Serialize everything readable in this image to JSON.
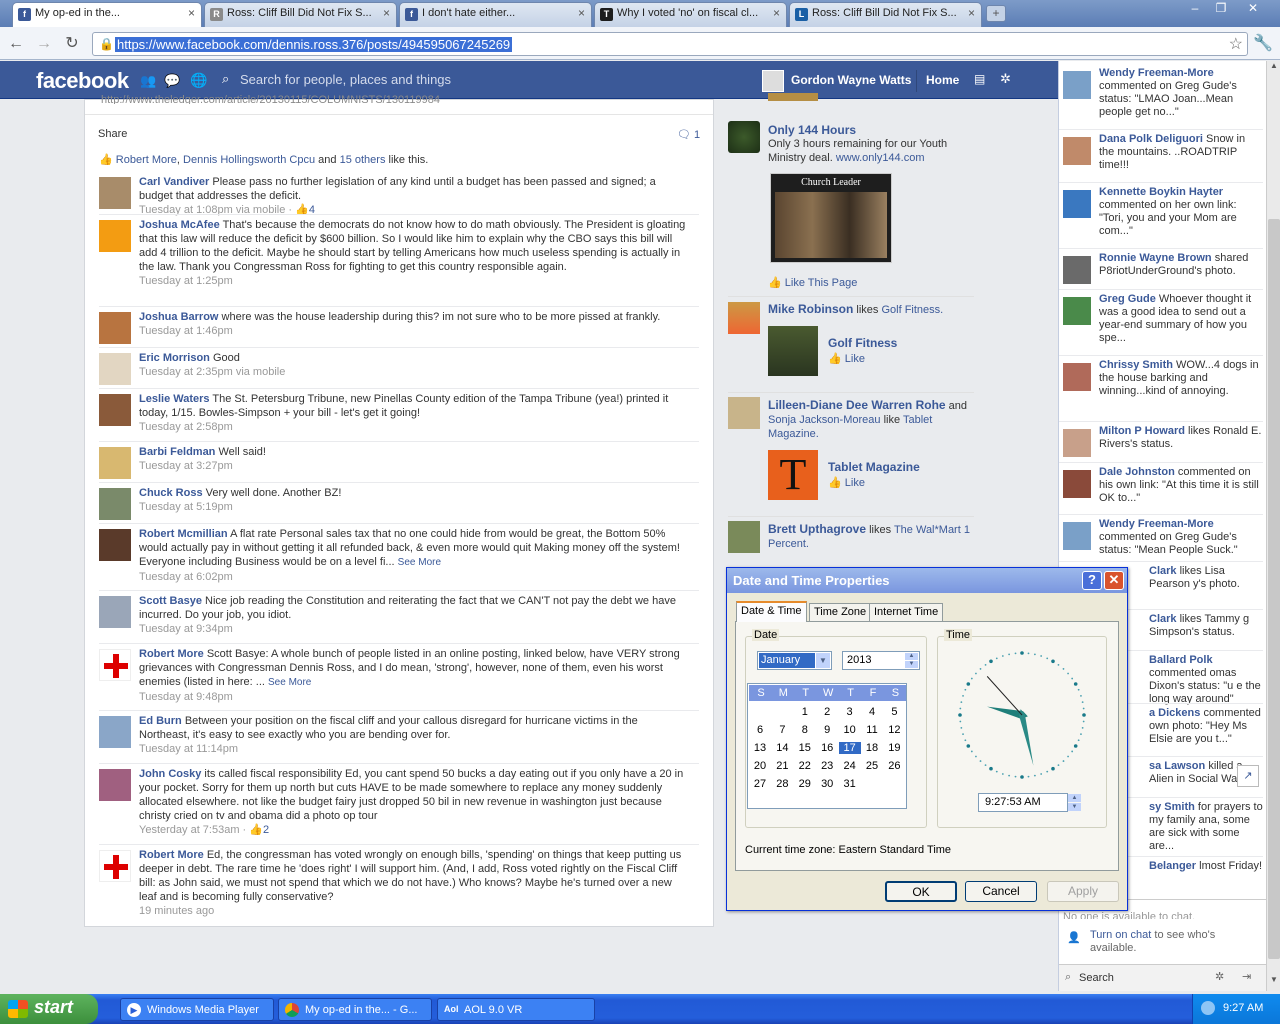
{
  "browser": {
    "tabs": [
      {
        "title": "My op-ed in the...",
        "icon": "facebook-icon"
      },
      {
        "title": "Ross: Cliff Bill Did Not Fix S...",
        "icon": "page-icon"
      },
      {
        "title": "I don't hate either...",
        "icon": "facebook-icon"
      },
      {
        "title": "Why I voted 'no' on fiscal cl...",
        "icon": "page-icon"
      },
      {
        "title": "Ross: Cliff Bill Did Not Fix S...",
        "icon": "page-icon"
      }
    ],
    "url": "https://www.facebook.com/dennis.ross.376/posts/494595067245269"
  },
  "fb": {
    "logo": "facebook",
    "search_placeholder": "Search for people, places and things",
    "user": "Gordon Wayne Watts",
    "home": "Home"
  },
  "post": {
    "link_fragment": "http://www.theledger.com/article/20130115/COLUMNISTS/130119984",
    "share": "Share",
    "comment_count": "1",
    "likes_text": {
      "a": "Robert More",
      "sep1": ",",
      "b": "Dennis Hollingsworth Cpcu",
      "and": "and",
      "others": "15 others",
      "tail": "like this."
    },
    "comments": [
      {
        "name": "Carl Vandiver",
        "text": "Please pass no further legislation of any kind until a budget has been passed and signed; a budget that addresses the deficit.",
        "meta": "Tuesday at 1:08pm via mobile",
        "likes": "4"
      },
      {
        "name": "Joshua McAfee",
        "text": "That's because the democrats do not know how to do math obviously. The President is gloating that this law will reduce the deficit by $600 billion. So I would like him to explain why the CBO says this bill will add 4 trillion to the deficit. Maybe he should start by telling Americans how much useless spending is actually in the law. Thank you Congressman Ross for fighting to get this country responsible again.",
        "meta": "Tuesday at 1:25pm",
        "likes": ""
      },
      {
        "name": "Joshua Barrow",
        "text": "where was the house leadership during this? im not sure who to be more pissed at frankly.",
        "meta": "Tuesday at 1:46pm",
        "likes": ""
      },
      {
        "name": "Eric Morrison",
        "text": "Good",
        "meta": "Tuesday at 2:35pm via mobile",
        "likes": ""
      },
      {
        "name": "Leslie Waters",
        "text": "The St. Petersburg Tribune, new Pinellas County edition of the Tampa Tribune (yea!) printed it today, 1/15. Bowles-Simpson + your bill - let's get it going!",
        "meta": "Tuesday at 2:58pm",
        "likes": ""
      },
      {
        "name": "Barbi Feldman",
        "text": "Well said!",
        "meta": "Tuesday at 3:27pm",
        "likes": ""
      },
      {
        "name": "Chuck Ross",
        "text": "Very well done. Another BZ!",
        "meta": "Tuesday at 5:19pm",
        "likes": ""
      },
      {
        "name": "Robert Mcmillian",
        "text": "A flat rate Personal sales tax that no one could hide from would be great, the Bottom 50% would actually pay in without getting it all refunded back, & even more would quit Making money off the system! Everyone including Business would be on a level fi...",
        "see_more": "See More",
        "meta": "Tuesday at 6:02pm",
        "likes": ""
      },
      {
        "name": "Scott Basye",
        "text": "Nice job reading the Constitution and reiterating the fact that we CAN'T not pay the debt we have incurred. Do your job, you idiot.",
        "meta": "Tuesday at 9:34pm",
        "likes": ""
      },
      {
        "name": "Robert More",
        "text": "Scott Basye: A whole bunch of people listed in an online posting, linked below, have VERY strong grievances with Congressman Dennis Ross, and I do mean, 'strong', however, none of them, even his worst enemies (listed in here: ...",
        "see_more": "See More",
        "meta": "Tuesday at 9:48pm",
        "likes": ""
      },
      {
        "name": "Ed Burn",
        "text": "Between your position on the fiscal cliff and your callous disregard for hurricane victims in the Northeast, it's easy to see exactly who you are bending over for.",
        "meta": "Tuesday at 11:14pm",
        "likes": ""
      },
      {
        "name": "John Cosky",
        "text": "its called fiscal responsibility Ed, you cant spend 50 bucks a day eating out if you only have a 20 in your pocket. Sorry for them up north but cuts HAVE to be made somewhere to replace any money suddenly allocated elsewhere. not like the budget fairy just dropped 50 bil in new revenue in washington just because christy cried on tv and obama did a photo op tour",
        "meta": "Yesterday at 7:53am",
        "likes": "2"
      },
      {
        "name": "Robert More",
        "text": "Ed, the congressman has voted wrongly on enough bills, 'spending' on things that keep putting us deeper in debt. The rare time he 'does right' I will support him. (And, I add, Ross voted rightly on the Fiscal Cliff bill: as John said, we must not spend that which we do not have.) Who knows? Maybe he's turned over a new leaf and is becoming fully conservative?",
        "meta": "19 minutes ago",
        "likes": ""
      }
    ]
  },
  "middle": {
    "ad_title": "Only 144 Hours",
    "ad_text": "Only 3 hours remaining for our Youth Ministry deal.",
    "ad_link": "www.only144.com",
    "ad_image_title": "Church Leader",
    "like_page": "Like This Page",
    "story1_name": "Mike Robinson",
    "story1_verb": "likes",
    "story1_obj": "Golf Fitness.",
    "story1_page": "Golf Fitness",
    "like": "Like",
    "story2_name": "Lilleen-Diane Dee Warren Rohe",
    "story2_and": "and",
    "story2_other": "Sonja Jackson-Moreau",
    "story2_verb": "like",
    "story2_obj": "Tablet Magazine.",
    "story2_page": "Tablet Magazine",
    "story2_logo": "T",
    "story3_name": "Brett Upthagrove",
    "story3_verb": "likes",
    "story3_obj": "The Wal*Mart 1 Percent."
  },
  "ticker": [
    {
      "name": "Wendy Freeman-More",
      "text": "commented on Greg Gude's status: \"LMAO Joan...Mean people get no...\""
    },
    {
      "name": "Dana Polk Deliguori",
      "text": "Snow in the mountains. ..ROADTRIP time!!!"
    },
    {
      "name": "Kennette Boykin Hayter",
      "text": "commented on her own link: \"Tori, you and your Mom are com...\""
    },
    {
      "name": "Ronnie Wayne Brown",
      "text": "shared P8riotUnderGround's photo."
    },
    {
      "name": "Greg Gude",
      "text": "Whoever thought it was a good idea to send out a year-end summary of how you spe..."
    },
    {
      "name": "Chrissy Smith",
      "text": "WOW...4 dogs in the house barking and winning...kind of annoying."
    },
    {
      "name": "Milton P Howard",
      "text": "likes Ronald E. Rivers's status."
    },
    {
      "name": "Dale Johnston",
      "text": "commented on his own link: \"At this time it is still OK to...\""
    },
    {
      "name": "Wendy Freeman-More",
      "text": "commented on Greg Gude's status: \"Mean People Suck.\""
    },
    {
      "name": "Clark",
      "text": "likes Lisa Pearson y's photo."
    },
    {
      "name": "Clark",
      "text": "likes Tammy g Simpson's status."
    },
    {
      "name": "Ballard Polk",
      "text": "commented omas Dixon's status: \"u e the long way around\""
    },
    {
      "name": "a Dickens",
      "text": "commented own photo: \"Hey Ms Elsie are you t...\""
    },
    {
      "name": "sa Lawson",
      "text": "killed a Alien in Social Wars."
    },
    {
      "name": "sy Smith",
      "text": "for prayers to my family ana, some are sick with some are..."
    },
    {
      "name": "Belanger",
      "text": "lmost Friday!"
    }
  ],
  "chat": {
    "unavailable": "No one is available to chat.",
    "turn_on": "Turn on chat",
    "turn_on_tail": "to see who's available.",
    "search": "Search"
  },
  "dialog": {
    "title": "Date and Time Properties",
    "tabs": [
      "Date & Time",
      "Time Zone",
      "Internet Time"
    ],
    "date_group": "Date",
    "time_group": "Time",
    "month": "January",
    "year": "2013",
    "weekdays": [
      "S",
      "M",
      "T",
      "W",
      "T",
      "F",
      "S"
    ],
    "selected_day": "17",
    "time": "9:27:53 AM",
    "clock": {
      "hour": 9,
      "minute": 27,
      "second": 53
    },
    "tz_label": "Current time zone:",
    "tz_value": "Eastern Standard Time",
    "ok": "OK",
    "cancel": "Cancel",
    "apply": "Apply"
  },
  "taskbar": {
    "start": "start",
    "items": [
      "Windows Media Player",
      "My op-ed in the... - G...",
      "AOL 9.0 VR"
    ],
    "clock": "9:27 AM"
  }
}
